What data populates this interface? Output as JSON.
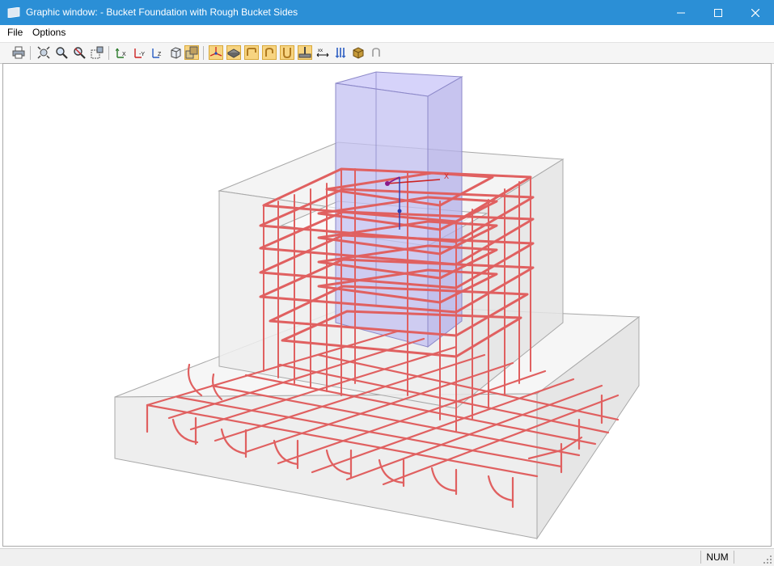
{
  "window": {
    "title": "Graphic window: - Bucket Foundation with Rough Bucket Sides",
    "accent_color": "#2b8fd6",
    "controls": [
      "minimize-icon",
      "maximize-icon",
      "close-icon"
    ]
  },
  "menu": {
    "items": [
      {
        "label": "File"
      },
      {
        "label": "Options"
      }
    ]
  },
  "toolbar": {
    "groups": [
      [
        "print-icon"
      ],
      [
        "zoom-all-icon",
        "zoom-icon",
        "zoom-previous-icon",
        "zoom-window-icon"
      ],
      [
        "view-x-icon",
        "view-minus-y-icon",
        "view-z-icon",
        "isometric-view-icon",
        "perspective-view-icon"
      ],
      [
        "axis-system-icon",
        "concrete-surface-icon",
        "stirrups-icon",
        "hooks-icon",
        "u-bars-icon",
        "footing-reinforcement-icon",
        "dimensions-icon",
        "reinforcement-marks-icon",
        "render-solid-icon",
        "bend-shape-icon"
      ]
    ],
    "active": [
      "perspective-view-icon",
      "axis-system-icon",
      "concrete-surface-icon",
      "stirrups-icon",
      "hooks-icon",
      "u-bars-icon",
      "footing-reinforcement-icon"
    ]
  },
  "viewport": {
    "content": "3D bucket foundation reinforcement model",
    "rebar_color": "#e06060",
    "concrete_color": "#d6d6d6",
    "column_color": "#b9b6f0",
    "axis_x_label": "X"
  },
  "statusbar": {
    "num_indicator": "NUM"
  }
}
